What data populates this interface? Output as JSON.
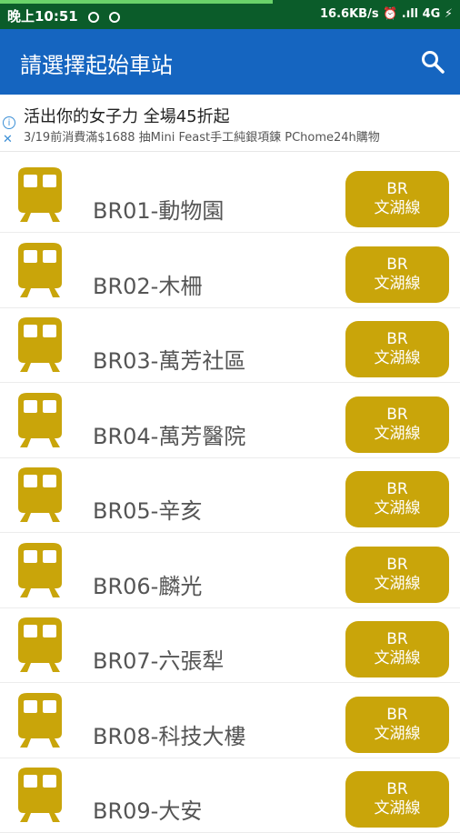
{
  "status_bar": {
    "time": "晚上10:51",
    "right": "16.6KB/s ⏰ .ıll 4G ⚡"
  },
  "app_bar": {
    "title": "請選擇起始車站",
    "search_icon": "search-icon"
  },
  "ad": {
    "title": "活出你的女子力 全場45折起",
    "subtitle": "3/19前消費滿$1688 抽Mini Feast手工純銀項鍊 PChome24h購物"
  },
  "stations": [
    {
      "name": "BR01-動物園",
      "line_code": "BR",
      "line_name": "文湖線"
    },
    {
      "name": "BR02-木柵",
      "line_code": "BR",
      "line_name": "文湖線"
    },
    {
      "name": "BR03-萬芳社區",
      "line_code": "BR",
      "line_name": "文湖線"
    },
    {
      "name": "BR04-萬芳醫院",
      "line_code": "BR",
      "line_name": "文湖線"
    },
    {
      "name": "BR05-辛亥",
      "line_code": "BR",
      "line_name": "文湖線"
    },
    {
      "name": "BR06-麟光",
      "line_code": "BR",
      "line_name": "文湖線"
    },
    {
      "name": "BR07-六張犁",
      "line_code": "BR",
      "line_name": "文湖線"
    },
    {
      "name": "BR08-科技大樓",
      "line_code": "BR",
      "line_name": "文湖線"
    },
    {
      "name": "BR09-大安",
      "line_code": "BR",
      "line_name": "文湖線"
    }
  ],
  "colors": {
    "app_bar": "#1565c0",
    "status_bar": "#0b5c2a",
    "line_brown": "#c9a50a"
  }
}
